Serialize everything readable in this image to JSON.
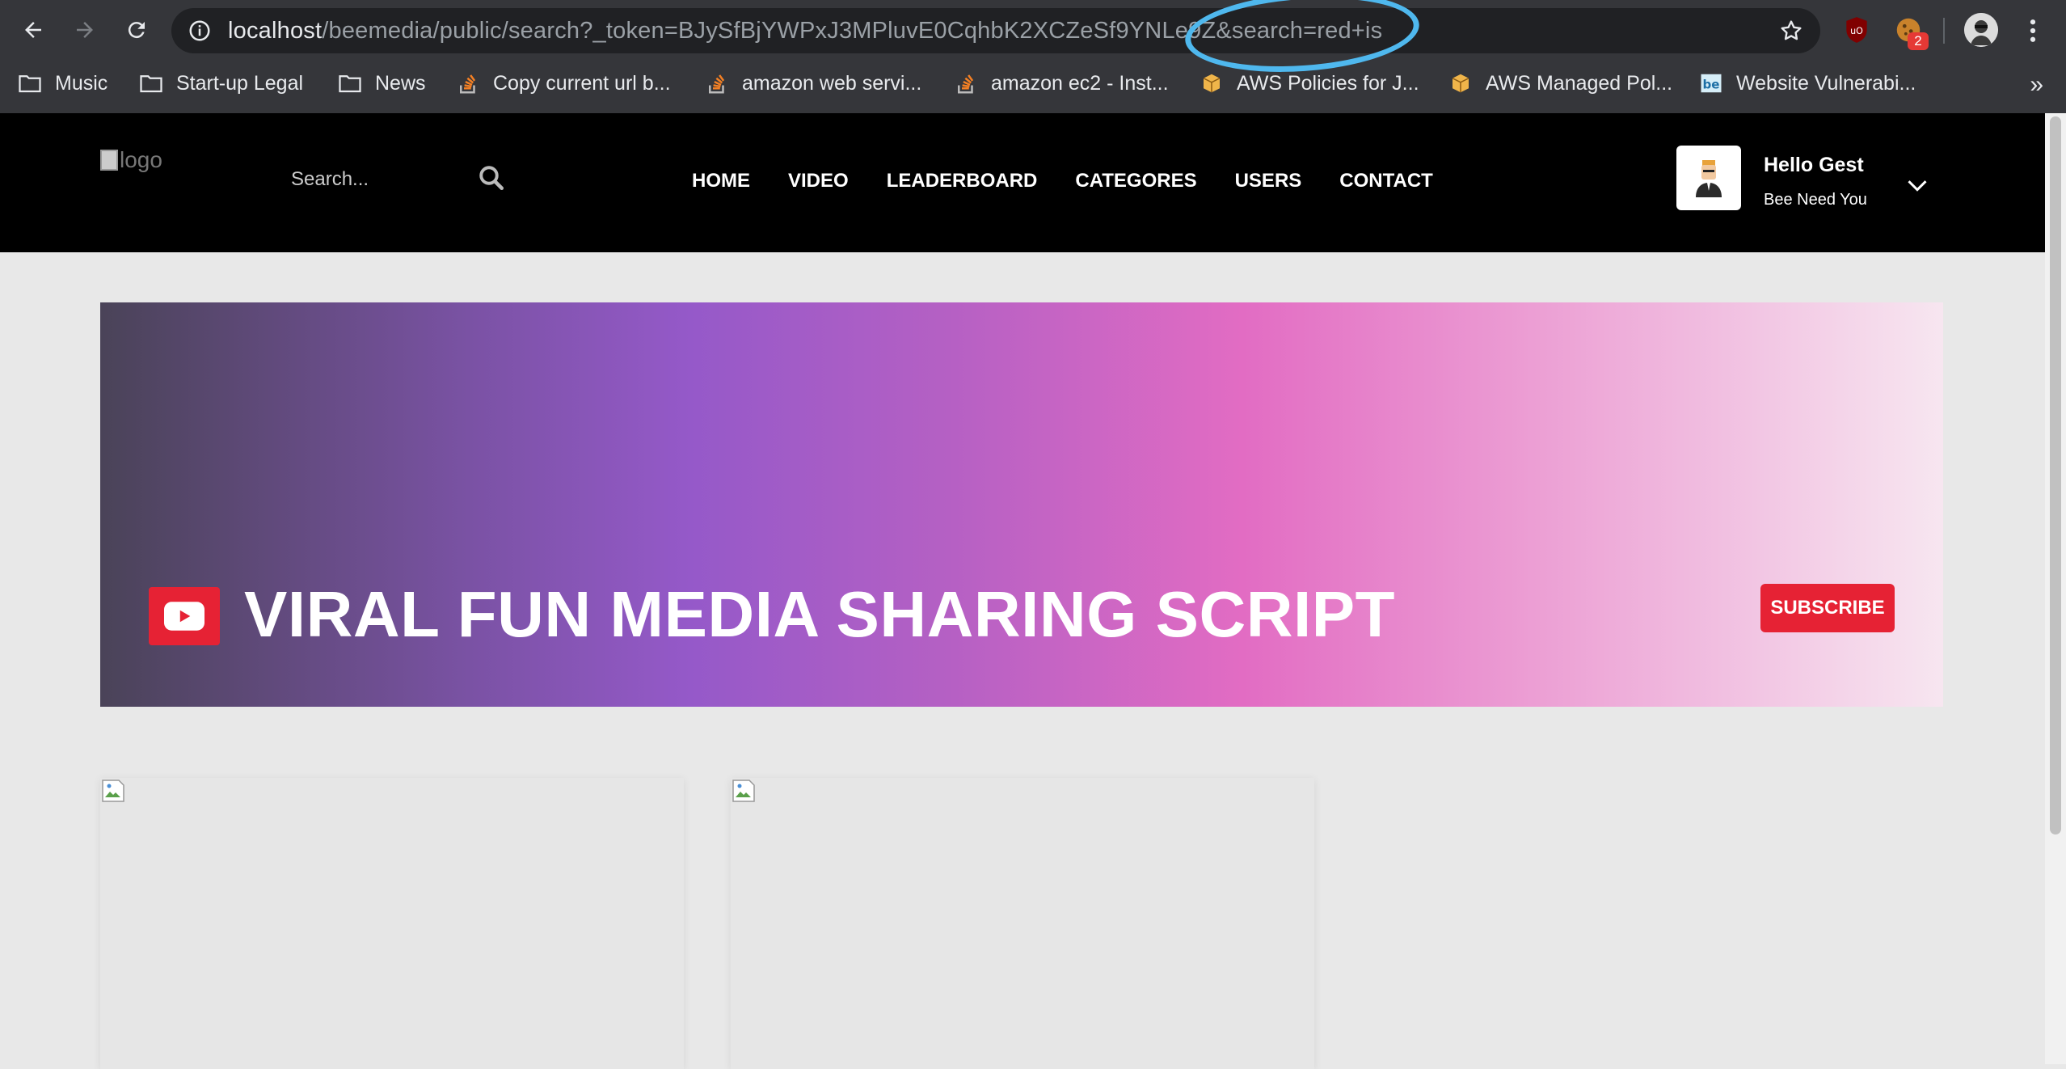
{
  "browser": {
    "url_host": "localhost",
    "url_path": "/beemedia/public/search?_token=BJySfBjYWPxJ3MPluvE0CqhbK2XCZeSf9YNLe​9Z&search=red+is",
    "extension_badge": "2",
    "bookmarks": [
      {
        "label": "Music",
        "icon": "folder-icon"
      },
      {
        "label": "Start-up Legal",
        "icon": "folder-icon"
      },
      {
        "label": "News",
        "icon": "folder-icon"
      },
      {
        "label": "Copy current url b...",
        "icon": "stackoverflow-icon"
      },
      {
        "label": "amazon web servi...",
        "icon": "stackoverflow-icon"
      },
      {
        "label": "amazon ec2 - Inst...",
        "icon": "stackoverflow-icon"
      },
      {
        "label": "AWS Policies for J...",
        "icon": "aws-icon"
      },
      {
        "label": "AWS Managed Pol...",
        "icon": "aws-icon"
      },
      {
        "label": "Website Vulnerabi...",
        "icon": "behance-icon"
      }
    ],
    "bookmarks_more": "»",
    "annotation_color": "#4fb8ee"
  },
  "site": {
    "logo_alt": "logo",
    "search_placeholder": "Search...",
    "menu": [
      "HOME",
      "VIDEO",
      "LEADERBOARD",
      "CATEGORES",
      "USERS",
      "CONTACT"
    ],
    "user": {
      "hello": "Hello Gest",
      "subtitle": "Bee Need You"
    }
  },
  "banner": {
    "title": "VIRAL FUN MEDIA SHARING SCRIPT",
    "subscribe_label": "SUBSCRIBE",
    "accent_color": "#e62234"
  }
}
